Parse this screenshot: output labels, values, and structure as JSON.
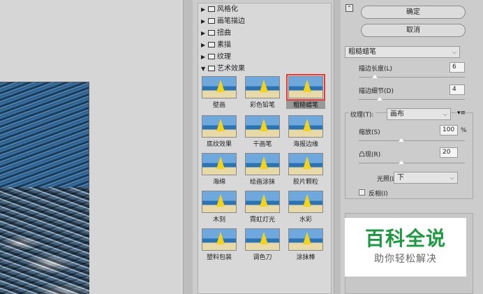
{
  "categories": [
    {
      "label": "风格化",
      "expanded": false
    },
    {
      "label": "画笔描边",
      "expanded": false
    },
    {
      "label": "扭曲",
      "expanded": false
    },
    {
      "label": "素描",
      "expanded": false
    },
    {
      "label": "纹理",
      "expanded": false
    },
    {
      "label": "艺术效果",
      "expanded": true
    }
  ],
  "filters": [
    "壁画",
    "彩色铅笔",
    "粗糙蜡笔",
    "底纹效果",
    "干画笔",
    "海报边缘",
    "海绵",
    "绘画涂抹",
    "胶片颗粒",
    "木刻",
    "霓虹灯光",
    "水彩",
    "塑料包装",
    "调色刀",
    "涂抹棒"
  ],
  "selected_filter": "粗糙蜡笔",
  "buttons": {
    "ok": "确定",
    "cancel": "取消"
  },
  "settings": {
    "filter_select": "粗糙蜡笔",
    "stroke_length": {
      "label": "描边长度(L)",
      "value": "6",
      "level": 0.15
    },
    "stroke_detail": {
      "label": "描边细节(D)",
      "value": "4",
      "level": 0.2
    },
    "texture": {
      "label": "纹理(T):",
      "value": "画布"
    },
    "scaling": {
      "label": "缩放(S)",
      "value": "100",
      "unit": "%",
      "level": 0.4
    },
    "relief": {
      "label": "凸现(R)",
      "value": "20",
      "level": 0.4
    },
    "light": {
      "label": "光照(L):",
      "value": "下"
    },
    "invert": {
      "label": "反相(I)",
      "checked": false
    }
  },
  "watermark": {
    "title": "百科全说",
    "subtitle": "助你轻松解决"
  }
}
